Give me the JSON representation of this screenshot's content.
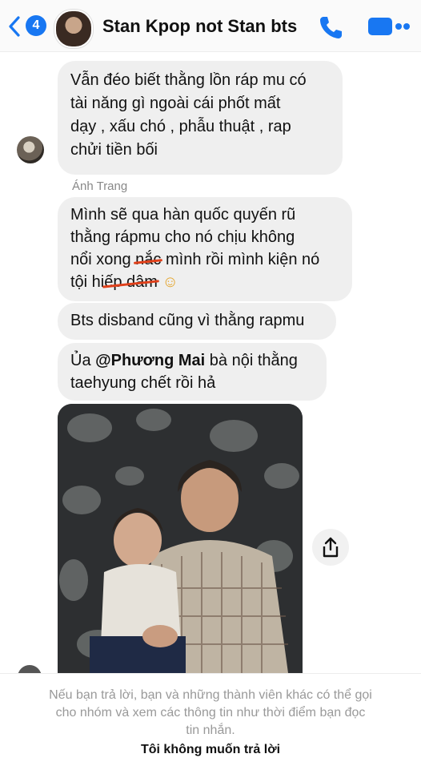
{
  "header": {
    "back_badge": "4",
    "title": "Stan Kpop not Stan bts",
    "icons": [
      "back-chevron-icon",
      "phone-icon",
      "video-camera-icon"
    ],
    "accent_color": "#1877f2"
  },
  "messages": [
    {
      "lines": [
        "Vẫn đéo biết thằng lồn ráp mu có",
        "tài năng gì ngoài cái phốt mất",
        "dạy , xấu chó , phẫu thuật , rap",
        "chửi tiền bối"
      ]
    },
    {
      "sender": "Ánh Trang",
      "line1": "Mình sẽ qua hàn quốc quyến rũ",
      "line2": "thằng rápmu cho nó chịu không",
      "line3_a": "nổi xong ",
      "line3_strike": "nắc",
      "line3_b": " mình rồi mình kiện nó",
      "line4_a": "tội hi",
      "line4_strike": "ếp dâm",
      "line4_emoji": " ☺"
    },
    {
      "text": "Bts disband cũng vì thằng rapmu"
    },
    {
      "prefix": "Ủa ",
      "mention": "@Phương Mai",
      "suffix": " bà nội thằng",
      "line2": "taehyung chết rồi hả"
    }
  ],
  "footer": {
    "notice_line1": "Nếu bạn trả lời, bạn và những thành viên khác có thể gọi",
    "notice_line2": "cho nhóm và xem các thông tin như thời điểm bạn đọc",
    "notice_line3": "tin nhắn.",
    "decline_button": "Tôi không muốn trả lời"
  }
}
